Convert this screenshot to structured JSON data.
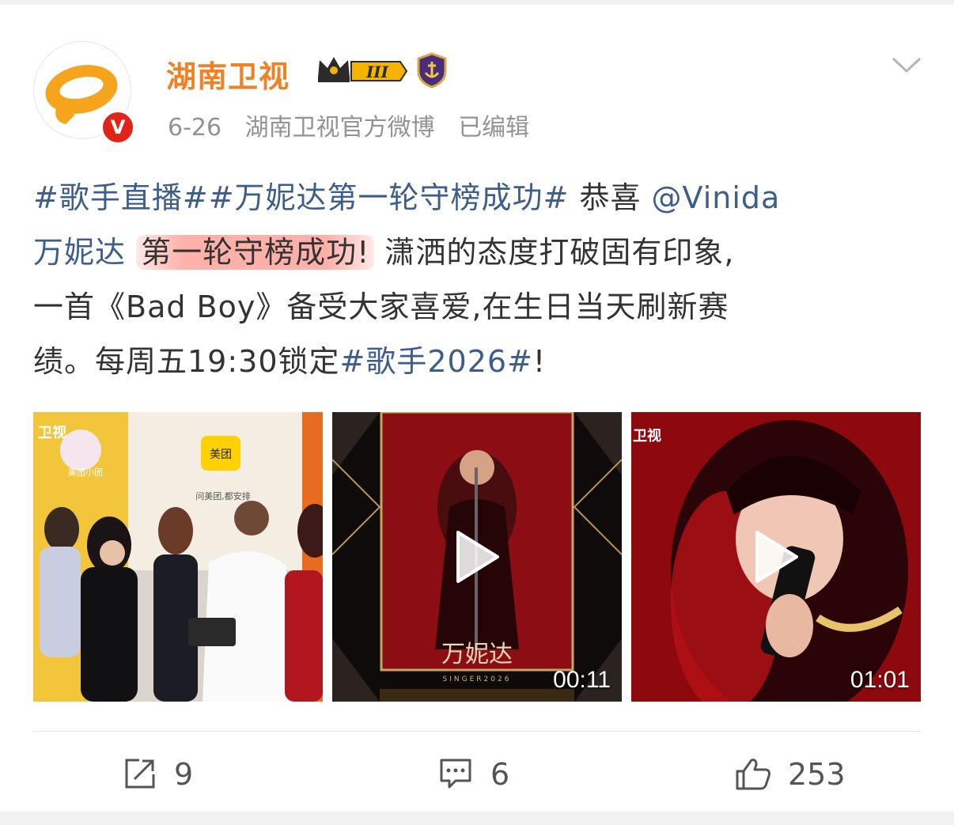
{
  "post": {
    "author": "湖南卫视",
    "date": "6-26",
    "source": "湖南卫视官方微博",
    "edited": "已编辑",
    "level_badge": "III",
    "verified_mark": "V",
    "text": {
      "tag1": "#歌手直播#",
      "tag2": "#万妮达第一轮守榜成功#",
      "congrats": " 恭喜 ",
      "mention_a": "@Vinida",
      "mention_b": "万妮达",
      "highlight": "第一轮守榜成功!",
      "line2_rest": " 潇洒的态度打破固有印象,",
      "line3": "一首《Bad Boy》备受大家喜爱,在生日当天刷新赛",
      "line4_start": "绩。每周五19:30锁定",
      "tag3": "#歌手2026#",
      "line4_end": "!"
    }
  },
  "media": [
    {
      "type": "image",
      "watermark_brand": "美团",
      "watermark_slogan": "问美团,都安排",
      "watermark_tv": "卫视",
      "watermark_app": "美团小团"
    },
    {
      "type": "video",
      "caption": "万妮达",
      "subcaption": "SINGER2026",
      "duration": "00:11",
      "icon": "play-icon"
    },
    {
      "type": "video",
      "watermark_tv": "卫视",
      "duration": "01:01",
      "icon": "play-icon"
    }
  ],
  "actions": {
    "repost": {
      "icon": "share-icon",
      "count": "9"
    },
    "comment": {
      "icon": "comment-icon",
      "count": "6"
    },
    "like": {
      "icon": "thumbs-up-icon",
      "count": "253"
    }
  },
  "colors": {
    "author": "#f08127",
    "link": "#3d5d8b",
    "highlight": "#ff968c",
    "verified": "#e2231a"
  }
}
